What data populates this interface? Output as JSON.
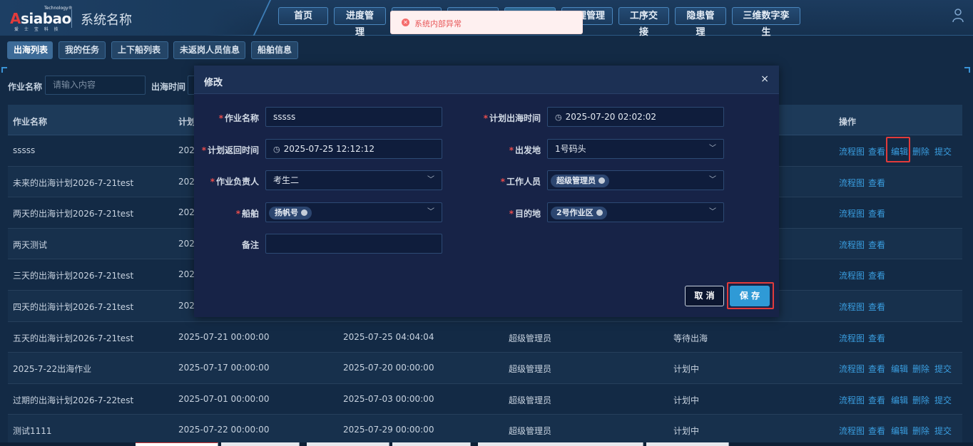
{
  "header": {
    "logo": {
      "small": "Technology®",
      "main_a": "A",
      "main_rest": "siabao",
      "sub": "爱 士 宝 科 技"
    },
    "system_name": "系统名称",
    "nav": [
      "首页",
      "进度管理",
      "",
      "",
      "",
      "理管理",
      "工序交接",
      "隐患管理",
      "三维数字孪生"
    ]
  },
  "toast": {
    "message": "系统内部异常",
    "icon": "error-circle-icon",
    "color": "#f56c6c"
  },
  "subtabs": [
    "出海列表",
    "我的任务",
    "上下船列表",
    "未返岗人员信息",
    "船舶信息"
  ],
  "filter": {
    "name_label": "作业名称",
    "name_placeholder": "请输入内容",
    "time_label": "出海时间"
  },
  "table": {
    "headers": [
      "作业名称",
      "计划",
      "操作"
    ],
    "rows": [
      {
        "name": "sssss",
        "start": "2025",
        "end": "",
        "owner": "",
        "status": "",
        "ops": [
          "流程图",
          "查看",
          "编辑",
          "删除",
          "提交"
        ]
      },
      {
        "name": "未来的出海计划2026-7-21test",
        "start": "2026",
        "end": "",
        "owner": "",
        "status": "",
        "ops": [
          "流程图",
          "查看"
        ]
      },
      {
        "name": "两天的出海计划2026-7-21test",
        "start": "2025",
        "end": "",
        "owner": "",
        "status": "",
        "ops": [
          "流程图",
          "查看"
        ]
      },
      {
        "name": "两天测试",
        "start": "2025",
        "end": "",
        "owner": "",
        "status": "",
        "ops": [
          "流程图",
          "查看"
        ]
      },
      {
        "name": "三天的出海计划2026-7-21test",
        "start": "2025",
        "end": "",
        "owner": "",
        "status": "",
        "ops": [
          "流程图",
          "查看"
        ]
      },
      {
        "name": "四天的出海计划2026-7-21test",
        "start": "2025",
        "end": "",
        "owner": "",
        "status": "",
        "ops": [
          "流程图",
          "查看"
        ]
      },
      {
        "name": "五天的出海计划2026-7-21test",
        "start": "2025-07-21 00:00:00",
        "end": "2025-07-25 04:04:04",
        "owner": "超级管理员",
        "status": "等待出海",
        "ops": [
          "流程图",
          "查看"
        ]
      },
      {
        "name": "2025-7-22出海作业",
        "start": "2025-07-17 00:00:00",
        "end": "2025-07-20 00:00:00",
        "owner": "超级管理员",
        "status": "计划中",
        "ops": [
          "流程图",
          "查看",
          "编辑",
          "删除",
          "提交"
        ]
      },
      {
        "name": "过期的出海计划2026-7-22test",
        "start": "2025-07-01 00:00:00",
        "end": "2025-07-03 00:00:00",
        "owner": "超级管理员",
        "status": "计划中",
        "ops": [
          "流程图",
          "查看",
          "编辑",
          "删除",
          "提交"
        ]
      },
      {
        "name": "测试1111",
        "start": "2025-07-22 00:00:00",
        "end": "2025-07-29 00:00:00",
        "owner": "超级管理员",
        "status": "计划中",
        "ops": [
          "流程图",
          "查看",
          "编辑",
          "删除",
          "提交"
        ]
      }
    ]
  },
  "modal": {
    "title": "修改",
    "close": "×",
    "fields": {
      "task_name": {
        "label": "作业名称",
        "value": "sssss"
      },
      "plan_out_time": {
        "label": "计划出海时间",
        "value": "2025-07-20 02:02:02"
      },
      "plan_return_time": {
        "label": "计划返回时间",
        "value": "2025-07-25 12:12:12"
      },
      "departure": {
        "label": "出发地",
        "value": "1号码头"
      },
      "owner": {
        "label": "作业负责人",
        "value": "考生二"
      },
      "staff": {
        "label": "工作人员",
        "tag": "超级管理员"
      },
      "ship": {
        "label": "船舶",
        "tag": "扬帆号"
      },
      "destination": {
        "label": "目的地",
        "tag": "2号作业区"
      },
      "remark": {
        "label": "备注",
        "value": ""
      }
    },
    "cancel": "取 消",
    "save": "保 存"
  },
  "colors": {
    "accent": "#2f9ad6",
    "link": "#3a9ee0",
    "required": "#e84d4d",
    "highlight": "#e23b3b"
  }
}
